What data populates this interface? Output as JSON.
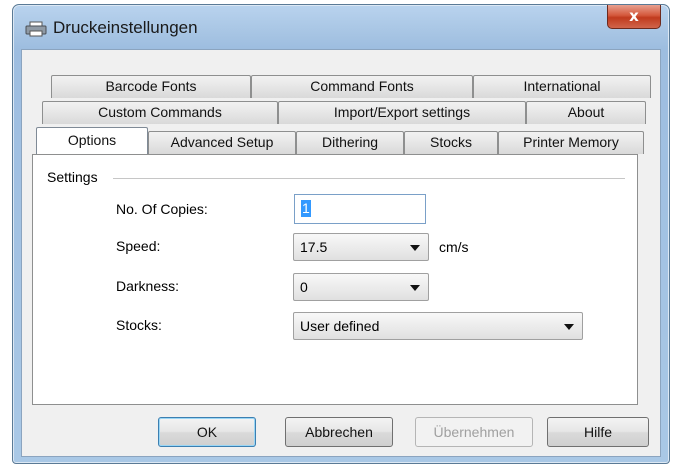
{
  "window": {
    "title": "Druckeinstellungen",
    "close_glyph": "x",
    "icon": "printer-icon"
  },
  "tabs": {
    "row1": [
      "Barcode Fonts",
      "Command Fonts",
      "International"
    ],
    "row2": [
      "Custom Commands",
      "Import/Export settings",
      "About"
    ],
    "row3": [
      "Options",
      "Advanced Setup",
      "Dithering",
      "Stocks",
      "Printer Memory"
    ],
    "active": "Options"
  },
  "settings": {
    "group_label": "Settings",
    "copies": {
      "label": "No. Of Copies:",
      "value": "1"
    },
    "speed": {
      "label": "Speed:",
      "value": "17.5",
      "unit": "cm/s"
    },
    "darkness": {
      "label": "Darkness:",
      "value": "0"
    },
    "stocks": {
      "label": "Stocks:",
      "value": "User defined"
    }
  },
  "buttons": {
    "ok": "OK",
    "cancel": "Abbrechen",
    "apply": "Übernehmen",
    "help": "Hilfe"
  },
  "colors": {
    "frame": "#a6c4e3",
    "close": "#c9452a",
    "selection": "#3399ff"
  }
}
